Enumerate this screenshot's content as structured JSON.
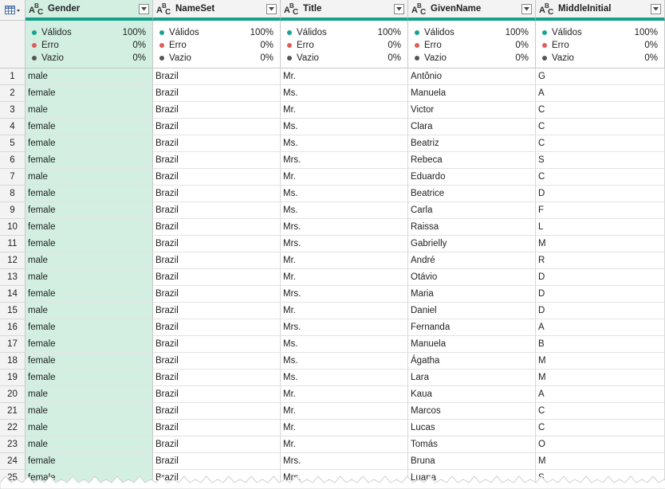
{
  "columns": [
    {
      "name": "Gender",
      "type_icon": "text-type-icon",
      "selected": true
    },
    {
      "name": "NameSet",
      "type_icon": "text-type-icon",
      "selected": false
    },
    {
      "name": "Title",
      "type_icon": "text-type-icon",
      "selected": false
    },
    {
      "name": "GivenName",
      "type_icon": "text-type-icon",
      "selected": false
    },
    {
      "name": "MiddleInitial",
      "type_icon": "text-type-icon",
      "selected": false
    }
  ],
  "stats": {
    "valid_label": "Válidos",
    "error_label": "Erro",
    "empty_label": "Vazio",
    "valid_value": "100%",
    "error_value": "0%",
    "empty_value": "0%",
    "valid_color": "#1aa391",
    "error_color": "#e45a5a",
    "empty_color": "#555555"
  },
  "colors": {
    "accent": "#16a08a",
    "selected_column": "#d2efe2"
  },
  "rows": [
    {
      "n": "1",
      "cells": [
        "male",
        "Brazil",
        "Mr.",
        "Antônio",
        "G"
      ]
    },
    {
      "n": "2",
      "cells": [
        "female",
        "Brazil",
        "Ms.",
        "Manuela",
        "A"
      ]
    },
    {
      "n": "3",
      "cells": [
        "male",
        "Brazil",
        "Mr.",
        "Victor",
        "C"
      ]
    },
    {
      "n": "4",
      "cells": [
        "female",
        "Brazil",
        "Ms.",
        "Clara",
        "C"
      ]
    },
    {
      "n": "5",
      "cells": [
        "female",
        "Brazil",
        "Ms.",
        "Beatriz",
        "C"
      ]
    },
    {
      "n": "6",
      "cells": [
        "female",
        "Brazil",
        "Mrs.",
        "Rebeca",
        "S"
      ]
    },
    {
      "n": "7",
      "cells": [
        "male",
        "Brazil",
        "Mr.",
        "Eduardo",
        "C"
      ]
    },
    {
      "n": "8",
      "cells": [
        "female",
        "Brazil",
        "Ms.",
        "Beatrice",
        "D"
      ]
    },
    {
      "n": "9",
      "cells": [
        "female",
        "Brazil",
        "Ms.",
        "Carla",
        "F"
      ]
    },
    {
      "n": "10",
      "cells": [
        "female",
        "Brazil",
        "Mrs.",
        "Raissa",
        "L"
      ]
    },
    {
      "n": "11",
      "cells": [
        "female",
        "Brazil",
        "Mrs.",
        "Gabrielly",
        "M"
      ]
    },
    {
      "n": "12",
      "cells": [
        "male",
        "Brazil",
        "Mr.",
        "André",
        "R"
      ]
    },
    {
      "n": "13",
      "cells": [
        "male",
        "Brazil",
        "Mr.",
        "Otávio",
        "D"
      ]
    },
    {
      "n": "14",
      "cells": [
        "female",
        "Brazil",
        "Mrs.",
        "Maria",
        "D"
      ]
    },
    {
      "n": "15",
      "cells": [
        "male",
        "Brazil",
        "Mr.",
        "Daniel",
        "D"
      ]
    },
    {
      "n": "16",
      "cells": [
        "female",
        "Brazil",
        "Mrs.",
        "Fernanda",
        "A"
      ]
    },
    {
      "n": "17",
      "cells": [
        "female",
        "Brazil",
        "Ms.",
        "Manuela",
        "B"
      ]
    },
    {
      "n": "18",
      "cells": [
        "female",
        "Brazil",
        "Ms.",
        "Ágatha",
        "M"
      ]
    },
    {
      "n": "19",
      "cells": [
        "female",
        "Brazil",
        "Ms.",
        "Lara",
        "M"
      ]
    },
    {
      "n": "20",
      "cells": [
        "male",
        "Brazil",
        "Mr.",
        "Kaua",
        "A"
      ]
    },
    {
      "n": "21",
      "cells": [
        "male",
        "Brazil",
        "Mr.",
        "Marcos",
        "C"
      ]
    },
    {
      "n": "22",
      "cells": [
        "male",
        "Brazil",
        "Mr.",
        "Lucas",
        "C"
      ]
    },
    {
      "n": "23",
      "cells": [
        "male",
        "Brazil",
        "Mr.",
        "Tomás",
        "O"
      ]
    },
    {
      "n": "24",
      "cells": [
        "female",
        "Brazil",
        "Mrs.",
        "Bruna",
        "M"
      ]
    },
    {
      "n": "25",
      "cells": [
        "female",
        "Brazil",
        "Mrs.",
        "Luana",
        "S"
      ]
    }
  ]
}
